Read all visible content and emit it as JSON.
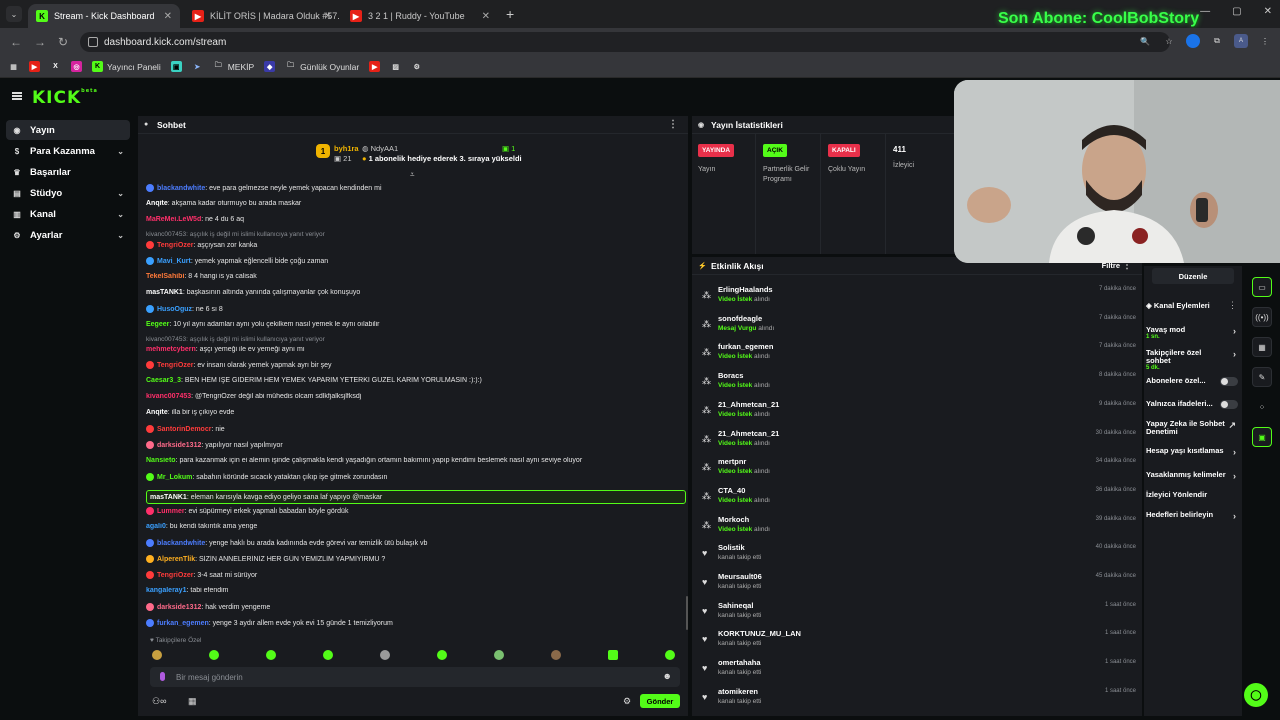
{
  "browser": {
    "tabs": [
      {
        "title": "Stream - Kick Dashboard",
        "active": true,
        "icon": "kick"
      },
      {
        "title": "KİLİT ORİS | Madara Olduk #57...",
        "active": false,
        "icon": "youtube"
      },
      {
        "title": "3 2 1 | Ruddy - YouTube",
        "active": false,
        "icon": "youtube"
      }
    ],
    "new_tab": "+",
    "url": "dashboard.kick.com/stream",
    "bookmarks": [
      {
        "label": "",
        "icon": "youtube"
      },
      {
        "label": "",
        "icon": "x"
      },
      {
        "label": "",
        "icon": "instagram"
      },
      {
        "label": "Yayıncı Paneli",
        "icon": "kick"
      },
      {
        "label": "",
        "icon": "app"
      },
      {
        "label": "",
        "icon": "app2"
      },
      {
        "label": "MEKİP",
        "icon": "folder"
      },
      {
        "label": "",
        "icon": "app3"
      },
      {
        "label": "Günlük Oyunlar",
        "icon": "folder"
      },
      {
        "label": "",
        "icon": "youtube"
      },
      {
        "label": "",
        "icon": "image"
      },
      {
        "label": "",
        "icon": "gear"
      }
    ]
  },
  "overlay": {
    "text": "Son Abone: CoolBobStory"
  },
  "sidebar": {
    "items": [
      {
        "label": "Yayın",
        "icon": "broadcast-icon",
        "active": true
      },
      {
        "label": "Para Kazanma",
        "icon": "money-icon",
        "chevron": true
      },
      {
        "label": "Başarılar",
        "icon": "trophy-icon"
      },
      {
        "label": "Stüdyo",
        "icon": "studio-icon",
        "chevron": true
      },
      {
        "label": "Kanal",
        "icon": "channel-icon",
        "chevron": true
      },
      {
        "label": "Ayarlar",
        "icon": "gear-icon",
        "chevron": true
      }
    ]
  },
  "chat": {
    "title": "Sohbet",
    "pinned": {
      "user1": "byh1ra",
      "count1": "21",
      "user2": "NdyAA1",
      "count2": "1",
      "message": "1 abonelik hediye ederek 3. sıraya yükseldi"
    },
    "messages": [
      {
        "user": "blackandwhite",
        "color": "#4c7dff",
        "text": ": eve para gelmezse neyle yemek yapacan kendinden mi",
        "badge": true
      },
      {
        "user": "Anqite",
        "color": "#ffffff",
        "text": ": akşama kadar oturmuyo bu arada maskar"
      },
      {
        "user": "MaReMei.LeW5d",
        "color": "#ff2f6a",
        "text": ": ne 4 du 6 aq"
      },
      {
        "reply": "kivanc007453: aşçılık iş değil mi islimi kullanıcıya yanıt veriyor"
      },
      {
        "user": "TengriOzer",
        "color": "#ff3b3b",
        "text": ": aşçıysan zor kanka",
        "badge": true
      },
      {
        "user": "Mavi_Kurt",
        "color": "#3aa0ff",
        "text": ": yemek yapmak eğlencelli bide çoğu zaman",
        "badge": true
      },
      {
        "user": "TekelSahibi",
        "color": "#ff7a3a",
        "text": ": 8 4 hangi is ya calisak"
      },
      {
        "user": "masTANK1",
        "color": "#ffffff",
        "text": ": başkasının altında yanında çalışmayanlar çok konuşuyo"
      },
      {
        "user": "HusoOguz",
        "color": "#3aa0ff",
        "text": ": ne 6 sı 8",
        "badge": true
      },
      {
        "user": "Eegeer",
        "color": "#53fc18",
        "text": ": 10 yıl aynı adamları aynı yolu çekilkem nasıl yemek le aynı oılabilir"
      },
      {
        "reply": "kivanc007453: aşçılık iş değil mi islimi kullanıcıya yanıt veriyor"
      },
      {
        "user": "mehmetcybern",
        "color": "#ff2f6a",
        "text": ": aşçı yemeği ile ev yemeği aynı mı"
      },
      {
        "user": "TengriOzer",
        "color": "#ff3b3b",
        "text": ": ev insanı olarak yemek yapmak ayrı bir şey",
        "badge": true
      },
      {
        "user": "Caesar3_3",
        "color": "#53fc18",
        "text": ": BEN HEM İŞE GİDERİM HEM YEMEK YAPARIM YETERKİ GÜZEL KARIM YORULMASIN :):):)"
      },
      {
        "user": "kivanc007453",
        "color": "#ff2f6a",
        "text": ": @TengriOzer değil abi mühedis olcam sdlkfjalksjlfksdj"
      },
      {
        "user": "Anqite",
        "color": "#ffffff",
        "text": ": illa bir iş çıkıyo evde"
      },
      {
        "user": "SantorinDemocr",
        "color": "#ff3b3b",
        "text": ": nie",
        "badge": true
      },
      {
        "user": "darkside1312",
        "color": "#ff6a8a",
        "text": ": yapılıyor nasıl yapılmıyor",
        "badge": true
      },
      {
        "user": "Nansieto",
        "color": "#53fc18",
        "text": ": para kazanmak için ei alemin işinde çalışmakla kendi yaşadığın ortamın bakımını yapıp kendimi beslemek nasıl aynı seviye oluyor"
      },
      {
        "user": "Mr_Lokum",
        "color": "#53fc18",
        "text": ": sabahın köründe sıcacık yataktan çıkıp işe gitmek zorundasın",
        "badge": true
      },
      {
        "user": "masTANK1",
        "color": "#ffffff",
        "text": ": eleman karısıyla kavga ediyo geliyo sana laf yapıyo @maskar",
        "highlight": true
      },
      {
        "user": "Lummer",
        "color": "#ff2f6a",
        "text": ": evi süpürmeyi erkek yapmalı babadan böyle gördük",
        "badge": true
      },
      {
        "user": "agali0",
        "color": "#3aa0ff",
        "text": ": bu kendi takıntık ama yenge"
      },
      {
        "user": "blackandwhite",
        "color": "#4c7dff",
        "text": ": yenge haklı bu arada kadınında evde görevi var temizlik ütü bulaşık vb",
        "badge": true
      },
      {
        "user": "AlperenTlik",
        "color": "#ffb020",
        "text": ": SİZİN ANNELERİNİZ HER GÜN YEMİZLİM YAPMİYİRMU ?",
        "badge": true
      },
      {
        "user": "TengriOzer",
        "color": "#ff3b3b",
        "text": ": 3-4 saat mi sürüyor",
        "badge": true
      },
      {
        "user": "kangaleray1",
        "color": "#3aa0ff",
        "text": ": tabi efendim"
      },
      {
        "user": "darkside1312",
        "color": "#ff6a8a",
        "text": ": hak verdim yengeme",
        "badge": true
      },
      {
        "user": "furkan_egemen",
        "color": "#4c7dff",
        "text": ": yenge 3 aydır allem evde yok evi 15 günde 1 temizliyorum",
        "badge": true
      }
    ],
    "followers_label": "Takipçilere Özel",
    "input_placeholder": "Bir mesaj gönderin",
    "send_label": "Gönder"
  },
  "stats": {
    "title": "Yayın İstatistikleri",
    "items": [
      {
        "badge": "YAYINDA",
        "badge_color": "#e8304a",
        "label": "Yayın"
      },
      {
        "badge": "AÇIK",
        "badge_color": "#53fc18",
        "label": "Partnerlik Gelir Programı"
      },
      {
        "badge": "KAPALI",
        "badge_color": "#e8304a",
        "label": "Çoklu Yayın"
      },
      {
        "badge": "411",
        "badge_color": "",
        "label": "İzleyici"
      }
    ]
  },
  "events": {
    "title": "Etkinlik Akışı",
    "filter": "Filtre",
    "items": [
      {
        "name": "ErlingHaalands",
        "action": "Video İstek",
        "suffix": " alındı",
        "time": "7 dakika önce",
        "type": "reward"
      },
      {
        "name": "sonofdeagle",
        "action": "Mesaj Vurgu",
        "suffix": " alındı",
        "time": "7 dakika önce",
        "type": "reward"
      },
      {
        "name": "furkan_egemen",
        "action": "Video İstek",
        "suffix": " alındı",
        "time": "7 dakika önce",
        "type": "reward"
      },
      {
        "name": "Boracs",
        "action": "Video İstek",
        "suffix": " alındı",
        "time": "8 dakika önce",
        "type": "reward"
      },
      {
        "name": "21_Ahmetcan_21",
        "action": "Video İstek",
        "suffix": " alındı",
        "time": "9 dakika önce",
        "type": "reward"
      },
      {
        "name": "21_Ahmetcan_21",
        "action": "Video İstek",
        "suffix": " alındı",
        "time": "30 dakika önce",
        "type": "reward"
      },
      {
        "name": "mertpnr",
        "action": "Video İstek",
        "suffix": " alındı",
        "time": "34 dakika önce",
        "type": "reward"
      },
      {
        "name": "CTA_40",
        "action": "Video İstek",
        "suffix": " alındı",
        "time": "36 dakika önce",
        "type": "reward"
      },
      {
        "name": "Morkoch",
        "action": "Video İstek",
        "suffix": " alındı",
        "time": "39 dakika önce",
        "type": "reward"
      },
      {
        "name": "Solistik",
        "action": "",
        "suffix": "kanalı takip etti",
        "time": "40 dakika önce",
        "type": "follow"
      },
      {
        "name": "Meursault06",
        "action": "",
        "suffix": "kanalı takip etti",
        "time": "45 dakika önce",
        "type": "follow"
      },
      {
        "name": "Sahineqal",
        "action": "",
        "suffix": "kanalı takip etti",
        "time": "1 saat önce",
        "type": "follow"
      },
      {
        "name": "KORKTUNUZ_MU_LAN",
        "action": "",
        "suffix": "kanalı takip etti",
        "time": "1 saat önce",
        "type": "follow"
      },
      {
        "name": "omertahaha",
        "action": "",
        "suffix": "kanalı takip etti",
        "time": "1 saat önce",
        "type": "follow"
      },
      {
        "name": "atomikeren",
        "action": "",
        "suffix": "kanalı takip etti",
        "time": "1 saat önce",
        "type": "follow"
      }
    ]
  },
  "actions": {
    "edit_label": "Düzenle",
    "title": "Kanal Eylemleri",
    "items": [
      {
        "label": "Yavaş mod",
        "sub": "1 sn.",
        "control": "arrow"
      },
      {
        "label": "Takipçilere özel sohbet",
        "sub": "5 dk.",
        "control": "arrow"
      },
      {
        "label": "Abonelere özel...",
        "sub": "",
        "control": "toggle"
      },
      {
        "label": "Yalnızca ifadeleri...",
        "sub": "",
        "control": "toggle"
      },
      {
        "label": "Yapay Zeka ile Sohbet Denetimi",
        "sub": "",
        "control": "external"
      },
      {
        "label": "Hesap yaşı kısıtlamas",
        "sub": "",
        "control": "arrow"
      },
      {
        "label": "Yasaklanmış kelimeler",
        "sub": "",
        "control": "arrow"
      },
      {
        "label": "İzleyici Yönlendir",
        "sub": "",
        "control": "none"
      },
      {
        "label": "Hedefleri belirleyin",
        "sub": "",
        "control": "arrow"
      }
    ]
  }
}
